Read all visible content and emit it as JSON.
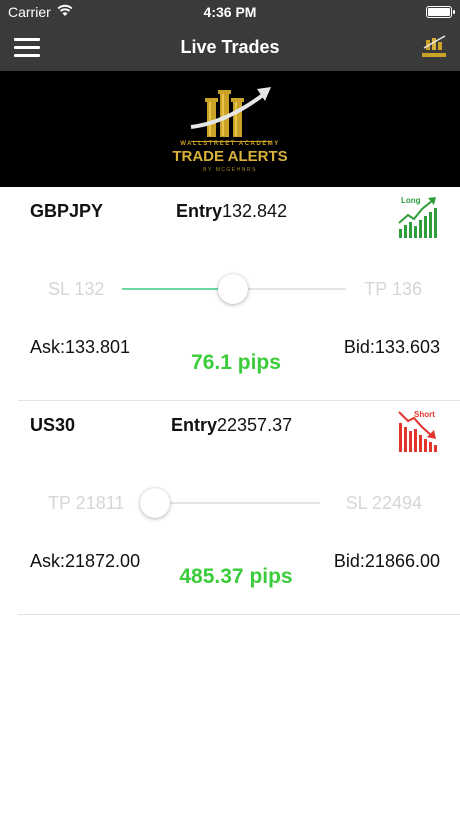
{
  "status_bar": {
    "carrier": "Carrier",
    "time": "4:36 PM"
  },
  "nav": {
    "title": "Live Trades",
    "menu_icon": "hamburger-menu-icon",
    "logo_icon": "trade-alerts-logo"
  },
  "banner": {
    "brand_small": "WALLSTREET ACADEMY",
    "brand_main": "TRADE ALERTS",
    "brand_sub": "BY MCGEHNRS"
  },
  "trades": [
    {
      "symbol": "GBPJPY",
      "entry_label": "Entry",
      "entry_value": "132.842",
      "direction": "Long",
      "range_left": "SL 132",
      "range_right": "TP 136",
      "progress": 0.49,
      "ask": "Ask:133.801",
      "bid": "Bid:133.603",
      "pips": "76.1 pips",
      "colors": {
        "direction": "#2e9e3a",
        "track_fill": "#6fd6a1",
        "pips": "#3acc3a"
      }
    },
    {
      "symbol": "US30",
      "entry_label": "Entry",
      "entry_value": "22357.37",
      "direction": "Short",
      "range_left": "TP 21811",
      "range_right": "SL 22494",
      "progress": 0.0,
      "ask": "Ask:21872.00",
      "bid": "Bid:21866.00",
      "pips": "485.37 pips",
      "colors": {
        "direction": "#e0342c",
        "track_fill": "#e5e5e5",
        "pips": "#3acc3a"
      }
    }
  ]
}
